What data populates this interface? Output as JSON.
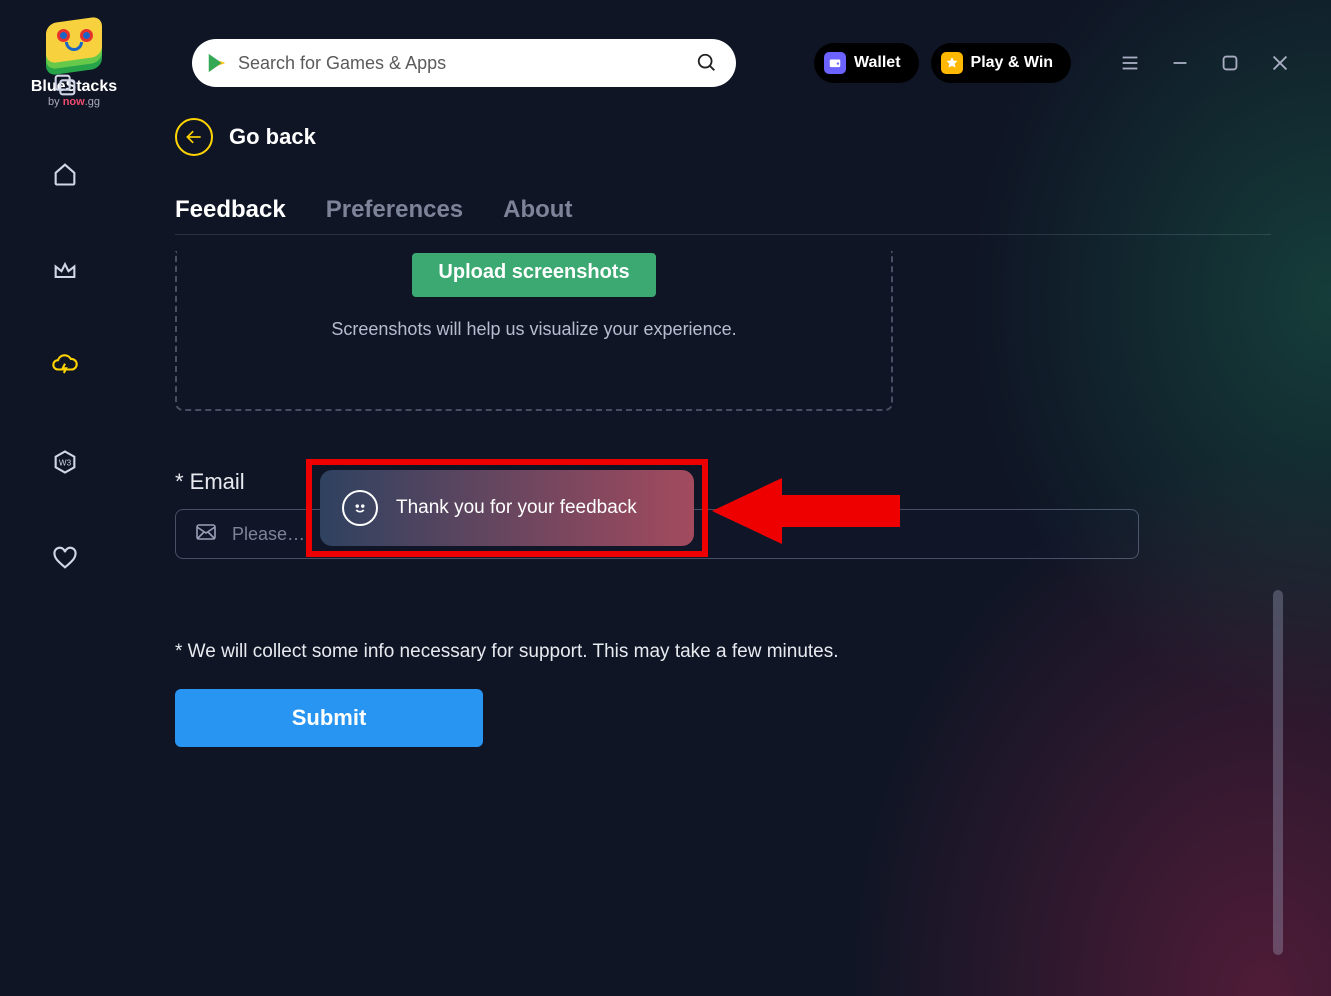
{
  "brand": {
    "name": "BlueStacks",
    "byline_prefix": "by ",
    "byline_brand": "now",
    "byline_suffix": ".gg"
  },
  "search": {
    "placeholder": "Search for Games & Apps"
  },
  "pills": {
    "wallet": "Wallet",
    "playwin": "Play & Win"
  },
  "nav": {
    "goback": "Go back",
    "tabs": {
      "feedback": "Feedback",
      "preferences": "Preferences",
      "about": "About"
    }
  },
  "upload": {
    "button": "Upload screenshots",
    "hint": "Screenshots will help us visualize your experience."
  },
  "email": {
    "label": "* Email",
    "placeholder": "Please…",
    "value": ""
  },
  "disclaimer": "* We will collect some info necessary for support. This may take a few minutes.",
  "submit": "Submit",
  "toast": {
    "message": "Thank you for your feedback"
  },
  "sidebar": {
    "items": [
      {
        "name": "home"
      },
      {
        "name": "crown"
      },
      {
        "name": "cloud-bolt",
        "active": true
      },
      {
        "name": "hex-w3"
      },
      {
        "name": "heart"
      }
    ],
    "bottom": [
      {
        "name": "layers"
      },
      {
        "name": "copy"
      }
    ]
  }
}
